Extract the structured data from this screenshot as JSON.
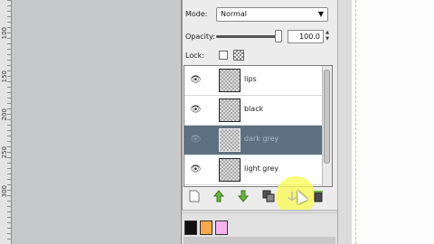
{
  "ruler": {
    "labels": [
      "100",
      "150",
      "200",
      "250",
      "300"
    ]
  },
  "layers_dialog": {
    "mode_label": "Mode:",
    "mode_value": "Normal",
    "opacity_label": "Opacity:",
    "opacity_value": "100.0",
    "opacity_fraction": 1.0,
    "lock_label": "Lock:",
    "layers": [
      {
        "name": "lips",
        "selected": false
      },
      {
        "name": "black",
        "selected": false
      },
      {
        "name": "dark grey",
        "selected": true
      },
      {
        "name": "light grey",
        "selected": false
      }
    ],
    "toolbar": [
      "new-layer-icon",
      "raise-layer-icon",
      "lower-layer-icon",
      "duplicate-layer-icon",
      "anchor-layer-icon",
      "delete-layer-icon"
    ]
  },
  "colors": {
    "selected_row": "#5d7182",
    "highlight": "#f7f75a",
    "swatch_black": "#111111",
    "swatch_orange": "#f5a94a",
    "swatch_pink": "#f4b4ee"
  }
}
